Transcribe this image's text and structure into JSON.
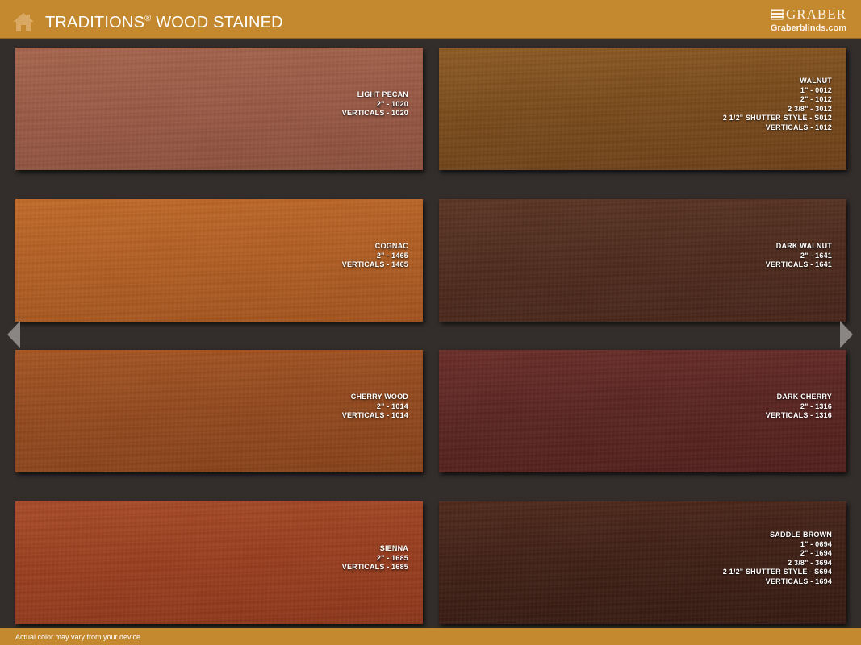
{
  "header": {
    "title": "TRADITIONS",
    "title_mark": "®",
    "title_suffix": " WOOD STAINED",
    "brand_name": "GRABER",
    "brand_url": "Graberblinds.com"
  },
  "swatches": [
    {
      "name": "LIGHT PECAN",
      "lines": [
        "2\" - 1020",
        "VERTICALS - 1020"
      ],
      "colors": [
        "#9a5a45",
        "#a8654c",
        "#8c4f3c"
      ]
    },
    {
      "name": "WALNUT",
      "lines": [
        "1\" - 0012",
        "2\" - 1012",
        "2 3/8\" - 3012",
        "2 1/2\" SHUTTER STYLE - S012",
        "VERTICALS - 1012"
      ],
      "colors": [
        "#7a4a1a",
        "#8e5b22",
        "#6d3f16"
      ]
    },
    {
      "name": "COGNAC",
      "lines": [
        "2\" - 1465",
        "VERTICALS - 1465"
      ],
      "colors": [
        "#b35f22",
        "#c26a28",
        "#a3531c"
      ]
    },
    {
      "name": "DARK WALNUT",
      "lines": [
        "2\" - 1641",
        "VERTICALS - 1641"
      ],
      "colors": [
        "#4e2a1c",
        "#5a3322",
        "#452318"
      ]
    },
    {
      "name": "CHERRY WOOD",
      "lines": [
        "2\" - 1014",
        "VERTICALS - 1014"
      ],
      "colors": [
        "#94491c",
        "#a65522",
        "#864018"
      ]
    },
    {
      "name": "DARK CHERRY",
      "lines": [
        "2\" - 1316",
        "VERTICALS - 1316"
      ],
      "colors": [
        "#5a2320",
        "#6a2c26",
        "#4e1d1a"
      ]
    },
    {
      "name": "SIENNA",
      "lines": [
        "2\" - 1685",
        "VERTICALS - 1685"
      ],
      "colors": [
        "#9b3e1e",
        "#a94a26",
        "#8c3519"
      ]
    },
    {
      "name": "SADDLE BROWN",
      "lines": [
        "1\" - 0694",
        "2\" - 1694",
        "2 3/8\" - 3694",
        "2 1/2\" SHUTTER STYLE - S694",
        "VERTICALS - 1694"
      ],
      "colors": [
        "#3e1e14",
        "#4e2819",
        "#33180f"
      ]
    }
  ],
  "nav": {
    "prev_icon": "chevron-left-icon",
    "next_icon": "chevron-right-icon"
  },
  "footer": {
    "disclaimer": "Actual color may vary from your device."
  }
}
